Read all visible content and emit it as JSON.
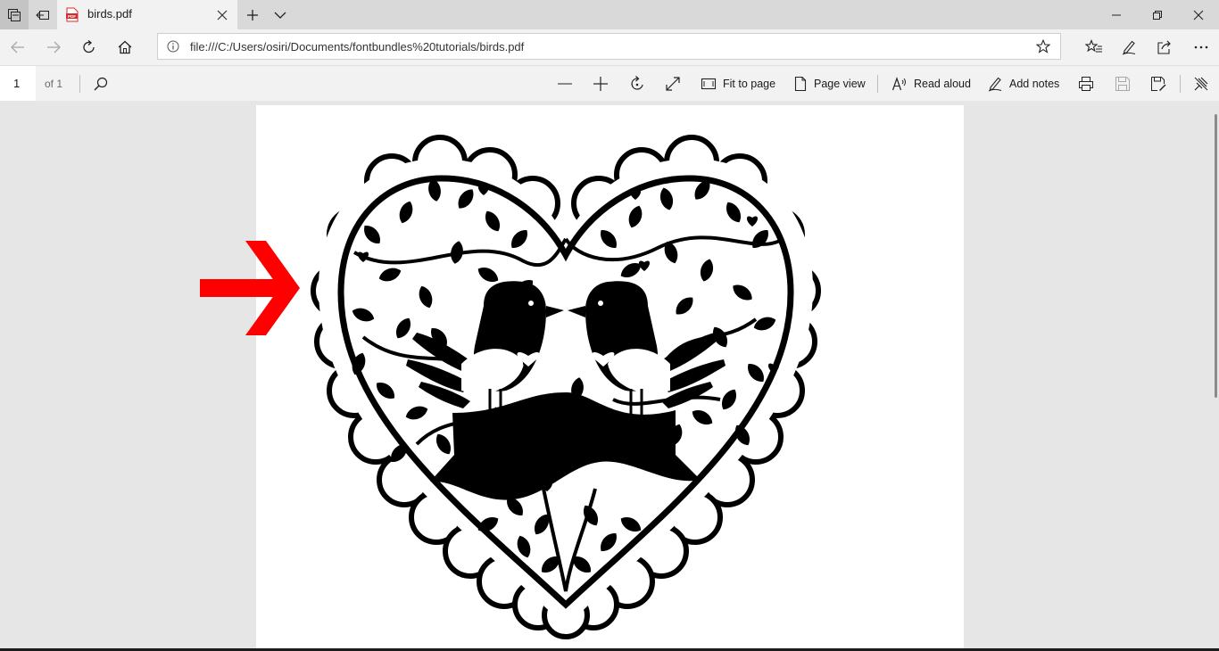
{
  "browser": {
    "tab": {
      "title": "birds.pdf",
      "favicon_label": "PDF"
    },
    "address": {
      "url": "file:///C:/Users/osiri/Documents/fontbundles%20tutorials/birds.pdf"
    }
  },
  "pdf_toolbar": {
    "page_number": "1",
    "page_of": "of 1",
    "fit_to_page": "Fit to page",
    "page_view": "Page view",
    "read_aloud": "Read aloud",
    "add_notes": "Add notes"
  },
  "colors": {
    "arrow": "#ff0000",
    "favicon": "#d32f2f",
    "artwork": "#000000"
  },
  "icons": [
    "tab-actions-icon",
    "set-tabs-aside-icon",
    "pdf-icon",
    "close-icon",
    "new-tab-icon",
    "chevron-down-icon",
    "minimize-icon",
    "restore-icon",
    "back-icon",
    "forward-icon",
    "refresh-icon",
    "home-icon",
    "info-icon",
    "favorite-star-icon",
    "favorites-icon",
    "pen-icon",
    "share-icon",
    "more-icon",
    "search-icon",
    "zoom-out-icon",
    "zoom-in-icon",
    "rotate-icon",
    "full-screen-icon",
    "fit-to-page-icon",
    "page-view-icon",
    "read-aloud-icon",
    "add-notes-icon",
    "print-icon",
    "save-icon",
    "save-as-icon",
    "unpin-toolbar-icon"
  ]
}
